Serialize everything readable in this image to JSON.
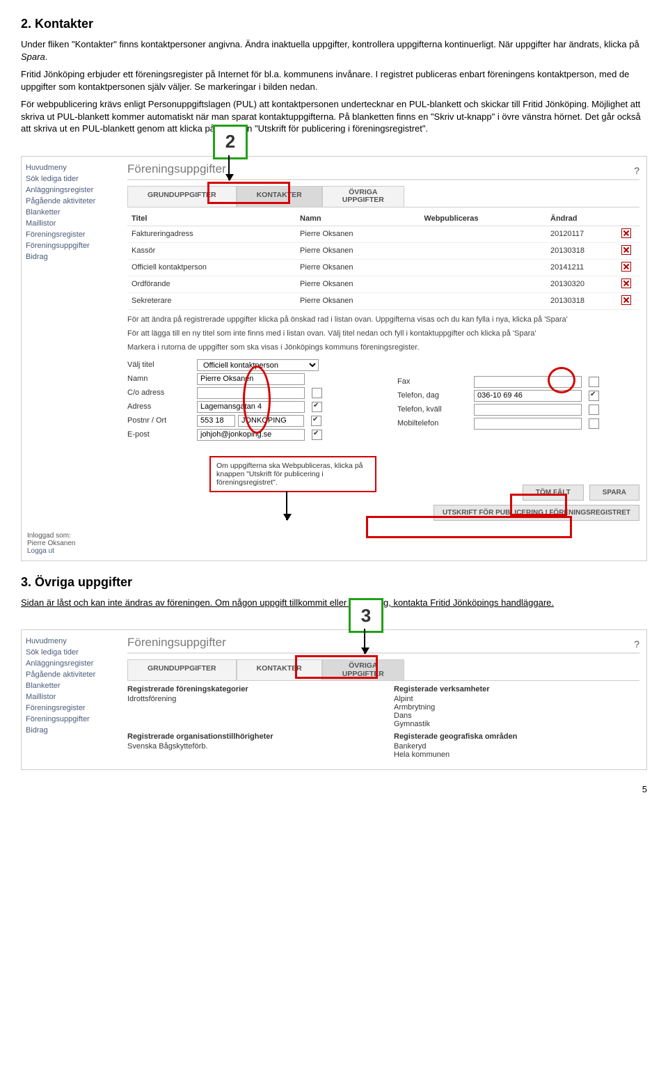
{
  "section2": {
    "heading": "2. Kontakter",
    "p1a": "Under fliken \"Kontakter\" finns kontaktpersoner angivna. Ändra inaktuella uppgifter, kontrollera uppgifterna kontinuerligt. När uppgifter har ändrats, klicka på ",
    "p1b": "Spara",
    "p1c": ".",
    "p2": "Fritid Jönköping erbjuder ett föreningsregister på Internet för bl.a. kommunens invånare. I registret publiceras enbart föreningens kontaktperson, med de uppgifter som kontaktpersonen själv väljer. Se markeringar i bilden nedan.",
    "p3": "För webpublicering krävs enligt Personuppgiftslagen (PUL) att kontaktpersonen undertecknar en PUL-blankett och skickar till Fritid Jönköping. Möjlighet att skriva ut PUL-blankett kommer automatiskt när man sparat kontaktuppgifterna. På blanketten finns en \"Skriv ut-knapp\" i övre vänstra hörnet. Det går också att skriva ut en PUL-blankett genom att klicka på knappen \"Utskrift för publicering i föreningsregistret\"."
  },
  "callout2": "2",
  "callout3": "3",
  "screenshot2": {
    "help": "?",
    "sidebar": [
      "Huvudmeny",
      "Sök lediga tider",
      "Anläggningsregister",
      "Pågående aktiviteter",
      "Blanketter",
      "Maillistor",
      "Föreningsregister",
      "Föreningsuppgifter",
      "Bidrag"
    ],
    "title": "Föreningsuppgifter",
    "tabs": {
      "t1": "GRUNDUPPGIFTER",
      "t2": "KONTAKTER",
      "t3a": "ÖVRIGA",
      "t3b": "UPPGIFTER"
    },
    "table": {
      "h1": "Titel",
      "h2": "Namn",
      "h3": "Webpubliceras",
      "h4": "Ändrad",
      "rows": [
        {
          "t": "Faktureringadress",
          "n": "Pierre Oksanen",
          "w": "",
          "d": "20120117"
        },
        {
          "t": "Kassör",
          "n": "Pierre Oksanen",
          "w": "",
          "d": "20130318"
        },
        {
          "t": "Officiell kontaktperson",
          "n": "Pierre Oksanen",
          "w": "",
          "d": "20141211"
        },
        {
          "t": "Ordförande",
          "n": "Pierre Oksanen",
          "w": "",
          "d": "20130320"
        },
        {
          "t": "Sekreterare",
          "n": "Pierre Oksanen",
          "w": "",
          "d": "20130318"
        }
      ]
    },
    "note1": "För att ändra på registrerade uppgifter klicka på önskad rad i listan ovan. Uppgifterna visas och du kan fylla i nya, klicka på 'Spara'",
    "note2": "För att lägga till en ny titel som inte finns med i listan ovan. Välj titel nedan och fyll i kontaktuppgifter och klicka på 'Spara'",
    "note3": "Markera i rutorna de uppgifter som ska visas i Jönköpings kommuns föreningsregister.",
    "form": {
      "valj_titel_l": "Välj titel",
      "valj_titel_v": "Officiell kontaktperson",
      "namn_l": "Namn",
      "namn_v": "Pierre Oksanen",
      "co_l": "C/o adress",
      "co_v": "",
      "adress_l": "Adress",
      "adress_v": "Lagemansgatan 4",
      "postnr_l": "Postnr / Ort",
      "postnr_v": "553 18",
      "ort_v": "JÖNKÖPING",
      "epost_l": "E-post",
      "epost_v": "johjoh@jonkoping.se",
      "fax_l": "Fax",
      "fax_v": "",
      "teld_l": "Telefon, dag",
      "teld_v": "036-10 69 46",
      "telk_l": "Telefon, kväll",
      "telk_v": "",
      "mobil_l": "Mobiltelefon",
      "mobil_v": ""
    },
    "rednote": "Om uppgifterna ska Webpubliceras, klicka på knappen \"Utskrift för publicering i föreningsregistret\".",
    "btn_tom": "TÖM FÄLT",
    "btn_spara": "SPARA",
    "btn_utskrift": "UTSKRIFT FÖR PUBLICERING I FÖRENINGSREGISTRET",
    "inlog_l": "Inloggad som:",
    "inlog_u": "Pierre Oksanen",
    "inlog_out": "Logga ut"
  },
  "section3": {
    "heading": "3. Övriga uppgifter",
    "p1": "Sidan är låst och kan inte ändras av föreningen. Om någon uppgift tillkommit eller är felaktig, kontakta Fritid Jönköpings handläggare."
  },
  "screenshot3": {
    "help": "?",
    "sidebar": [
      "Huvudmeny",
      "Sök lediga tider",
      "Anläggningsregister",
      "Pågående aktiviteter",
      "Blanketter",
      "Maillistor",
      "Föreningsregister",
      "Föreningsuppgifter",
      "Bidrag"
    ],
    "title": "Föreningsuppgifter",
    "tabs": {
      "t1": "GRUNDUPPGIFTER",
      "t2": "KONTAKTER",
      "t3a": "ÖVRIGA",
      "t3b": "UPPGIFTER"
    },
    "grid": {
      "a_l": "Registrerade föreningskategorier",
      "a_v": "Idrottsförening",
      "b_l": "Registerade verksamheter",
      "b_v": "Alpint\nArmbrytning\nDans\nGymnastik",
      "c_l": "Registrerade organisationstillhörigheter",
      "c_v": "Svenska Bågskytteförb.",
      "d_l": "Registerade geografiska områden",
      "d_v": "Bankeryd\nHela kommunen"
    }
  },
  "page_no": "5"
}
